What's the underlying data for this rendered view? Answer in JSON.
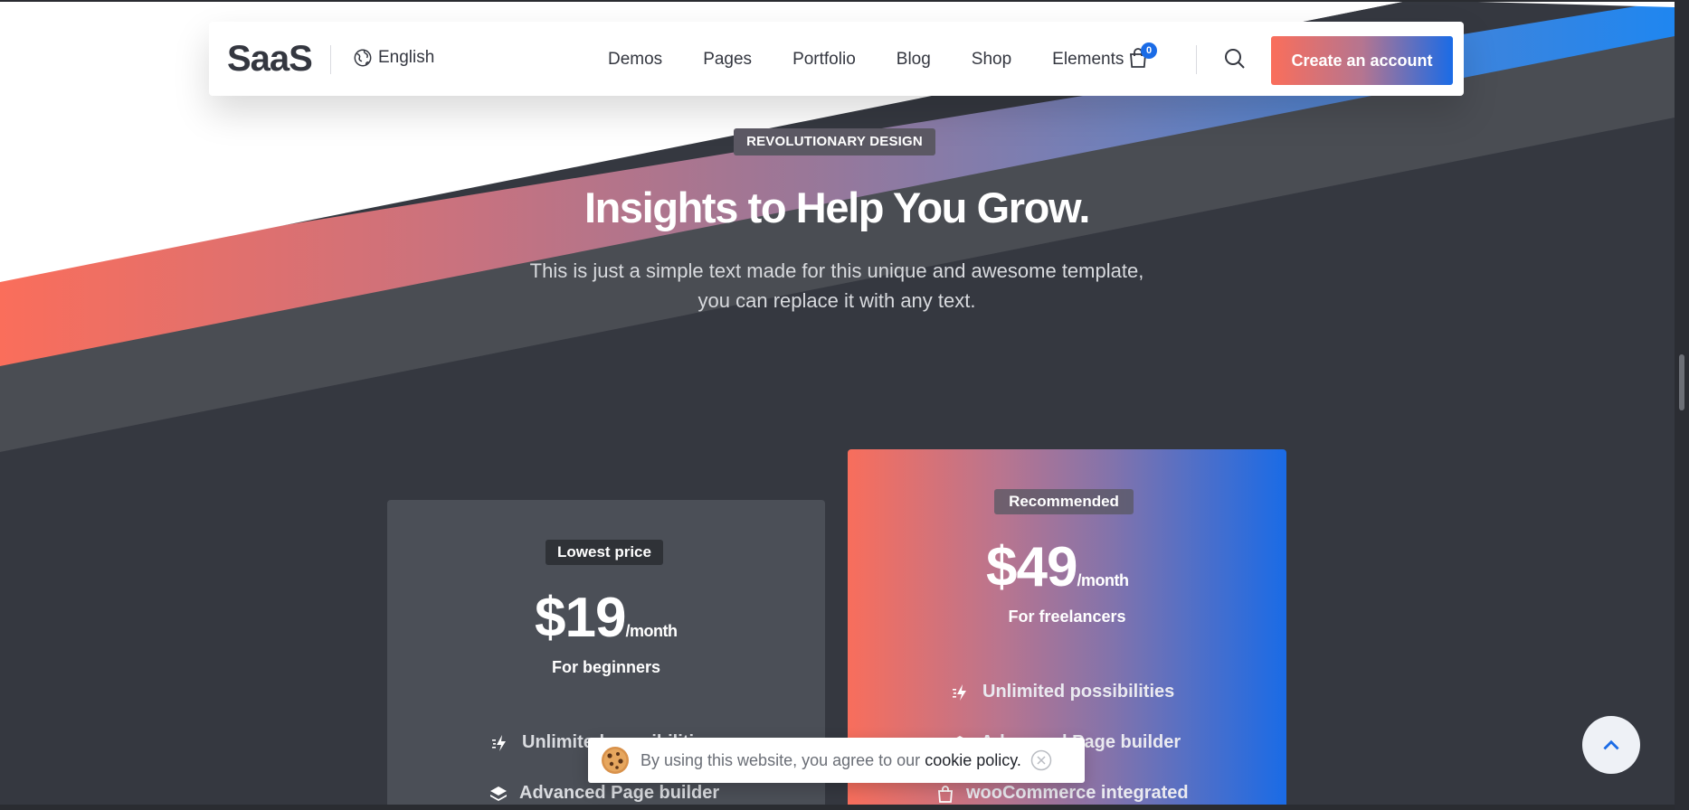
{
  "header": {
    "logo": "SaaS",
    "language": "English",
    "nav": [
      "Demos",
      "Pages",
      "Portfolio",
      "Blog",
      "Shop",
      "Elements"
    ],
    "cart_count": "0",
    "cta_label": "Create an account"
  },
  "hero": {
    "eyebrow": "REVOLUTIONARY DESIGN",
    "headline": "Insights to Help You Grow.",
    "subtitle": "This is just a simple text made for this unique and awesome template, you can replace it with any text."
  },
  "pricing": [
    {
      "tag": "Lowest price",
      "price": "$19",
      "period": "/month",
      "plan": "For beginners",
      "features": [
        "Unlimited possibilities",
        "Advanced Page builder"
      ]
    },
    {
      "tag": "Recommended",
      "price": "$49",
      "period": "/month",
      "plan": "For freelancers",
      "features": [
        "Unlimited possibilities",
        "Advanced Page builder",
        "wooCommerce integrated"
      ]
    }
  ],
  "cookie": {
    "message": "By using this website, you agree to our",
    "link": "cookie policy."
  },
  "colors": {
    "brand_gradient_start": "#fa6e5b",
    "brand_gradient_end": "#1a6be6",
    "dark_bg": "#353840"
  },
  "icons": [
    "globe-icon",
    "cart-icon",
    "search-icon",
    "lightning-icon",
    "layers-icon",
    "bag-icon",
    "cookie-icon",
    "close-icon",
    "chevron-up-icon"
  ]
}
